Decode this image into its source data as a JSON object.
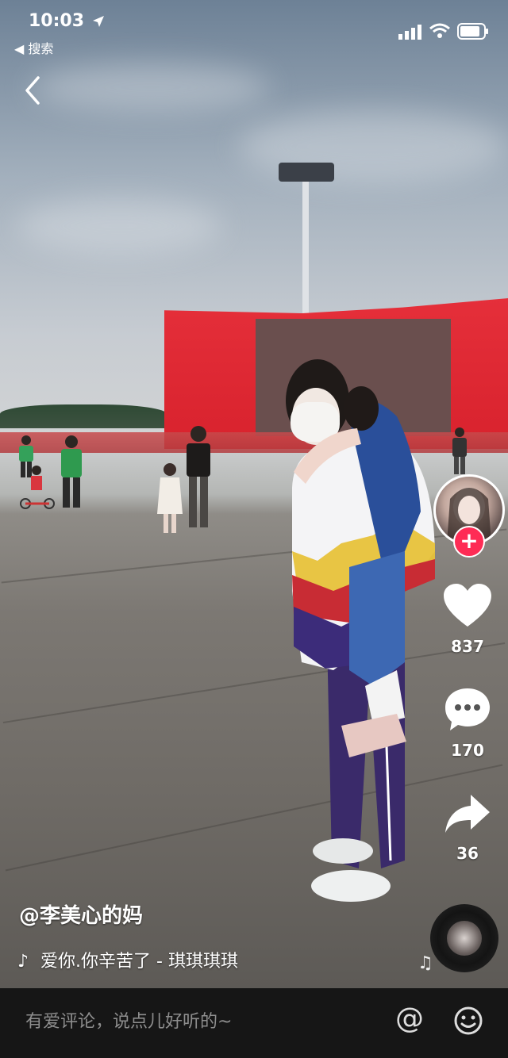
{
  "status_bar": {
    "time": "10:03",
    "back_app_label": "搜索"
  },
  "icons": {
    "back": "chevron-left-icon",
    "like": "heart-icon",
    "comment": "comment-bubble-icon",
    "share": "share-arrow-icon",
    "music": "music-note-icon",
    "mention": "at-sign-icon",
    "emoji": "smiley-icon"
  },
  "sidebar": {
    "follow_label": "+",
    "likes": "837",
    "comments": "170",
    "shares": "36"
  },
  "video": {
    "author": "@李美心的妈",
    "music": "爱你.你辛苦了 - 琪琪琪琪"
  },
  "comment_bar": {
    "placeholder": "有爱评论，说点儿好听的~",
    "at_label": "@"
  },
  "colors": {
    "accent": "#fe2c55",
    "bottom_bar": "#161616"
  }
}
